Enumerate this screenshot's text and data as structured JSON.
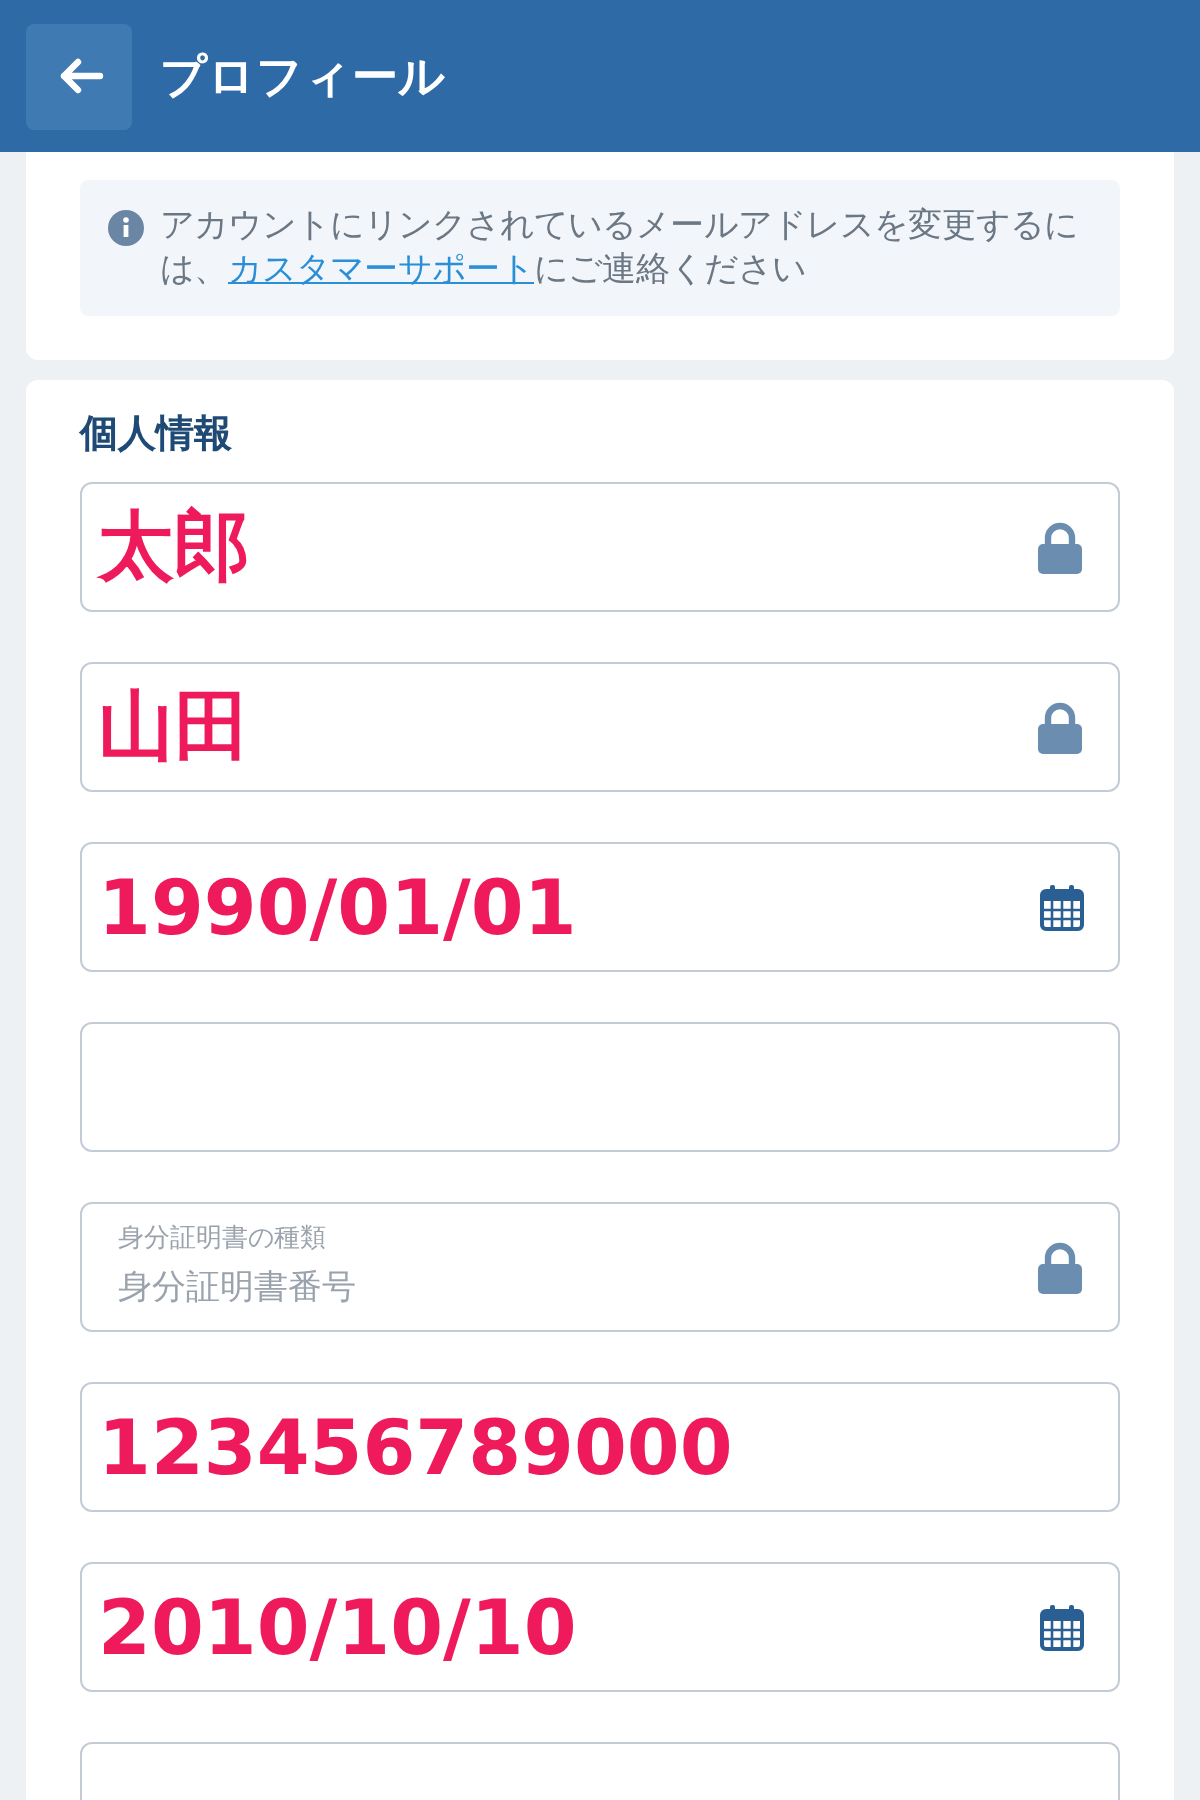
{
  "header": {
    "title": "プロフィール"
  },
  "notice": {
    "text_before": "アカウントにリンクされているメールアドレスを変更するには、",
    "link": "カスタマーサポート",
    "text_after": "にご連絡ください"
  },
  "section": {
    "title": "個人情報",
    "fields": [
      {
        "value": "太郎",
        "kind": "locked"
      },
      {
        "value": "山田",
        "kind": "locked"
      },
      {
        "value": "1990/01/01",
        "kind": "date"
      },
      {
        "kind": "text"
      },
      {
        "label": "身分証明書の種類",
        "placeholder": "身分証明書番号",
        "kind": "locked"
      },
      {
        "value": "123456789000",
        "kind": "text"
      },
      {
        "value": "2010/10/10",
        "kind": "date"
      },
      {
        "kind": "text"
      }
    ]
  }
}
